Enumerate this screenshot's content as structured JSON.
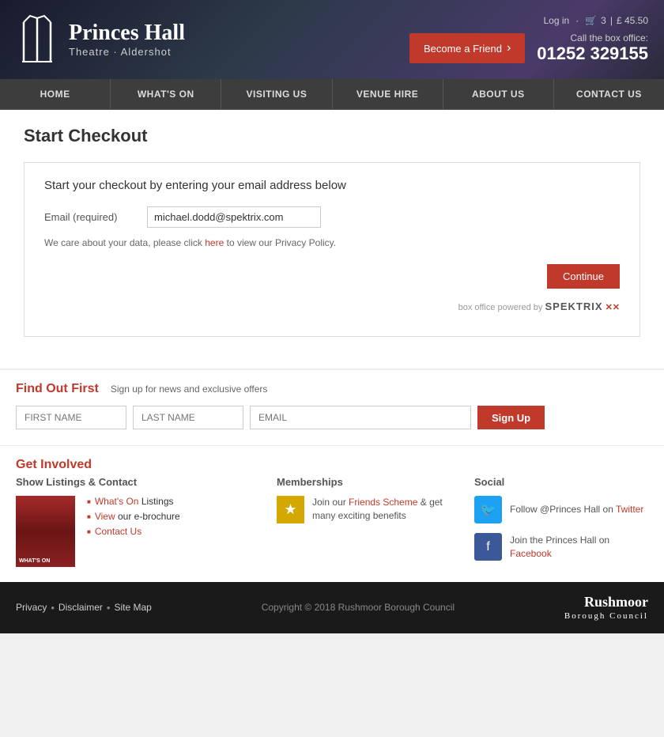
{
  "header": {
    "logo_name": "Princes Hall",
    "logo_subtitle": "Theatre · Aldershot",
    "login_label": "Log in",
    "basket_count": "3",
    "basket_amount": "£ 45.50",
    "become_friend_label": "Become a Friend",
    "box_office_label": "Call the box office:",
    "phone_number": "01252 329155"
  },
  "nav": {
    "items": [
      {
        "label": "HOME",
        "id": "home"
      },
      {
        "label": "WHAT'S ON",
        "id": "whats-on"
      },
      {
        "label": "VISITING US",
        "id": "visiting-us"
      },
      {
        "label": "VENUE HIRE",
        "id": "venue-hire"
      },
      {
        "label": "ABOUT US",
        "id": "about-us"
      },
      {
        "label": "CONTACT US",
        "id": "contact-us"
      }
    ]
  },
  "checkout": {
    "page_title": "Start Checkout",
    "intro_text": "Start your checkout by entering your email address below",
    "email_label": "Email (required)",
    "email_value": "michael.dodd@spektrix.com",
    "privacy_text": "We care about your data, please click",
    "privacy_link_text": "here",
    "privacy_after": " to view our Privacy Policy.",
    "continue_label": "Continue",
    "powered_by_text": "box office powered by",
    "powered_by_brand": "SPEKTRIX"
  },
  "newsletter": {
    "title": "Find Out First",
    "subtitle": "Sign up for news and exclusive offers",
    "first_name_placeholder": "FIRST NAME",
    "last_name_placeholder": "LAST NAME",
    "email_placeholder": "EMAIL",
    "signup_label": "Sign Up"
  },
  "get_involved": {
    "title": "Get Involved",
    "listings_title": "Show Listings & Contact",
    "links": [
      {
        "bold": "What's On",
        "rest": " Listings"
      },
      {
        "bold": "View",
        "rest": " our e-brochure"
      },
      {
        "bold": "Contact Us",
        "rest": ""
      }
    ],
    "memberships_title": "Memberships",
    "membership_text": "Join our",
    "membership_link": "Friends Scheme",
    "membership_rest": " & get many exciting benefits",
    "social_title": "Social",
    "twitter_line1": "Follow @Princes Hall on",
    "twitter_link": "Twitter",
    "facebook_line1": "Join the Princes Hall on",
    "facebook_link": "Facebook"
  },
  "footer": {
    "privacy_label": "Privacy",
    "disclaimer_label": "Disclaimer",
    "sitemap_label": "Site Map",
    "copyright": "Copyright © 2018 Rushmoor Borough Council",
    "rushmoor_line1": "Rushmoor",
    "rushmoor_line2": "Borough Council"
  }
}
